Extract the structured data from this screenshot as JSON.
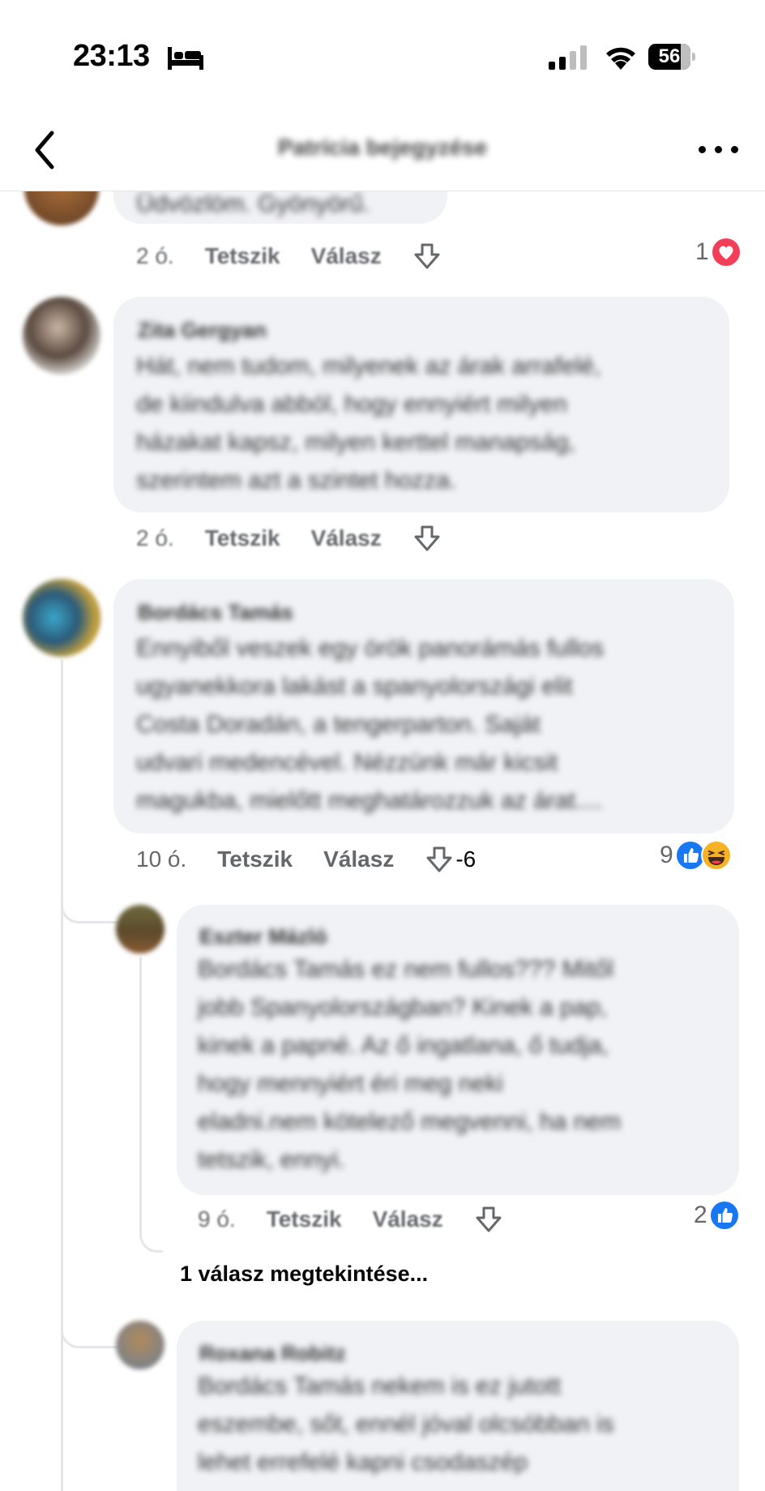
{
  "status_bar": {
    "time": "23:13",
    "battery": "56"
  },
  "nav": {
    "title": "Patrícia bejegyzése"
  },
  "comments": [
    {
      "author": "",
      "text": "Üdvözlöm. Gyönyörű.",
      "time": "2 ó.",
      "like_label": "Tetszik",
      "reply_label": "Válasz",
      "reaction_count": "1",
      "reaction_icons": [
        "love-icon"
      ]
    },
    {
      "author": "Zita Gergyan",
      "text": "Hát, nem tudom, milyenek az árak arrafelé,\nde kiindulva abból, hogy ennyiért milyen\nházakat kapsz, milyen kerttel manapság,\nszerintem azt a szintet hozza.",
      "time": "2 ó.",
      "like_label": "Tetszik",
      "reply_label": "Válasz"
    },
    {
      "author": "Bordács Tamás",
      "text": "Ennyiből veszek egy örök panorámás fullos\nugyanekkora lakást a spanyolországi elit\nCosta Doradán, a tengerparton. Saját\nudvari medencével. Nézzünk már kicsit\nmagukba, mielőtt meghatározzuk az árat....",
      "time": "10 ó.",
      "like_label": "Tetszik",
      "reply_label": "Válasz",
      "vote": "-6",
      "reaction_count": "9",
      "reaction_icons": [
        "like-icon",
        "haha-icon"
      ]
    }
  ],
  "replies": [
    {
      "author": "Eszter Mázló",
      "text": "Bordács Tamás ez nem fullos??? Mitől\njobb Spanyolországban? Kinek a pap,\nkinek a papné. Az ő ingatlana, ő tudja,\nhogy mennyiért éri meg  neki\neladni.nem kötelező megvenni, ha nem\ntetszik, ennyi.",
      "time": "9 ó.",
      "like_label": "Tetszik",
      "reply_label": "Válasz",
      "reaction_count": "2",
      "reaction_icons": [
        "like-icon"
      ]
    },
    {
      "author": "Roxana Robitz",
      "text": "Bordács Tamás nekem is ez jutott\neszembe, sőt, ennél jóval olcsóbban is\nlehet errefelé kapni csodaszép"
    }
  ],
  "view_replies": "1 válasz megtekintése...",
  "colors": {
    "bubble": "#f0f2f5",
    "meta": "#65676b",
    "like_blue": "#1877f2",
    "love_red": "#f33e58",
    "haha_yellow": "#f7b125"
  }
}
